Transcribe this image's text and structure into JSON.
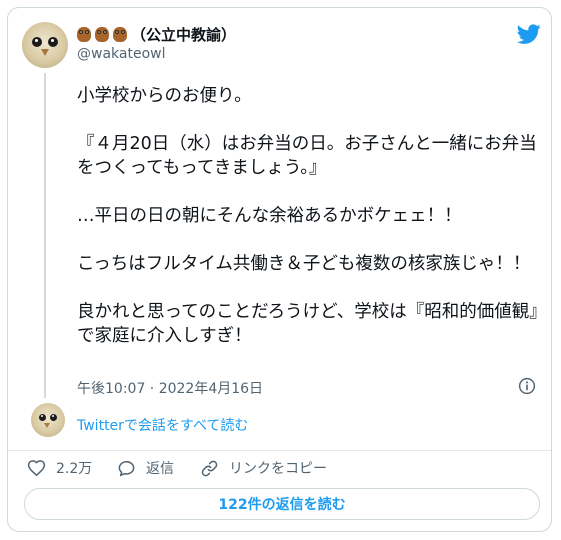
{
  "author": {
    "emoji_icons": [
      "owl-emoji",
      "owl-emoji",
      "owl-emoji"
    ],
    "display_name": "（公立中教諭）",
    "handle": "@wakateowl"
  },
  "tweet": {
    "text": "小学校からのお便り。\n\n『４月20日（水）はお弁当の日。お子さんと一緒にお弁当をつくってもってきましょう。』\n\n…平日の日の朝にそんな余裕あるかボケェェ！！\n\nこっちはフルタイム共働き＆子ども複数の核家族じゃ！！\n\n良かれと思ってのことだろうけど、学校は『昭和的価値観』で家庭に介入しすぎ！",
    "timestamp": "午後10:07 · 2022年4月16日"
  },
  "thread": {
    "read_link": "Twitterで会話をすべて読む"
  },
  "actions": {
    "like_count": "2.2万",
    "reply_label": "返信",
    "copy_link_label": "リンクをコピー"
  },
  "replies_button": "122件の返信を読む",
  "colors": {
    "accent": "#1d9bf0",
    "muted": "#536471",
    "text": "#0f1419",
    "border": "#cfd9de"
  },
  "icons": {
    "brand": "twitter-bird-icon",
    "info": "info-icon",
    "like": "heart-icon",
    "reply": "reply-icon",
    "copy": "link-icon"
  }
}
